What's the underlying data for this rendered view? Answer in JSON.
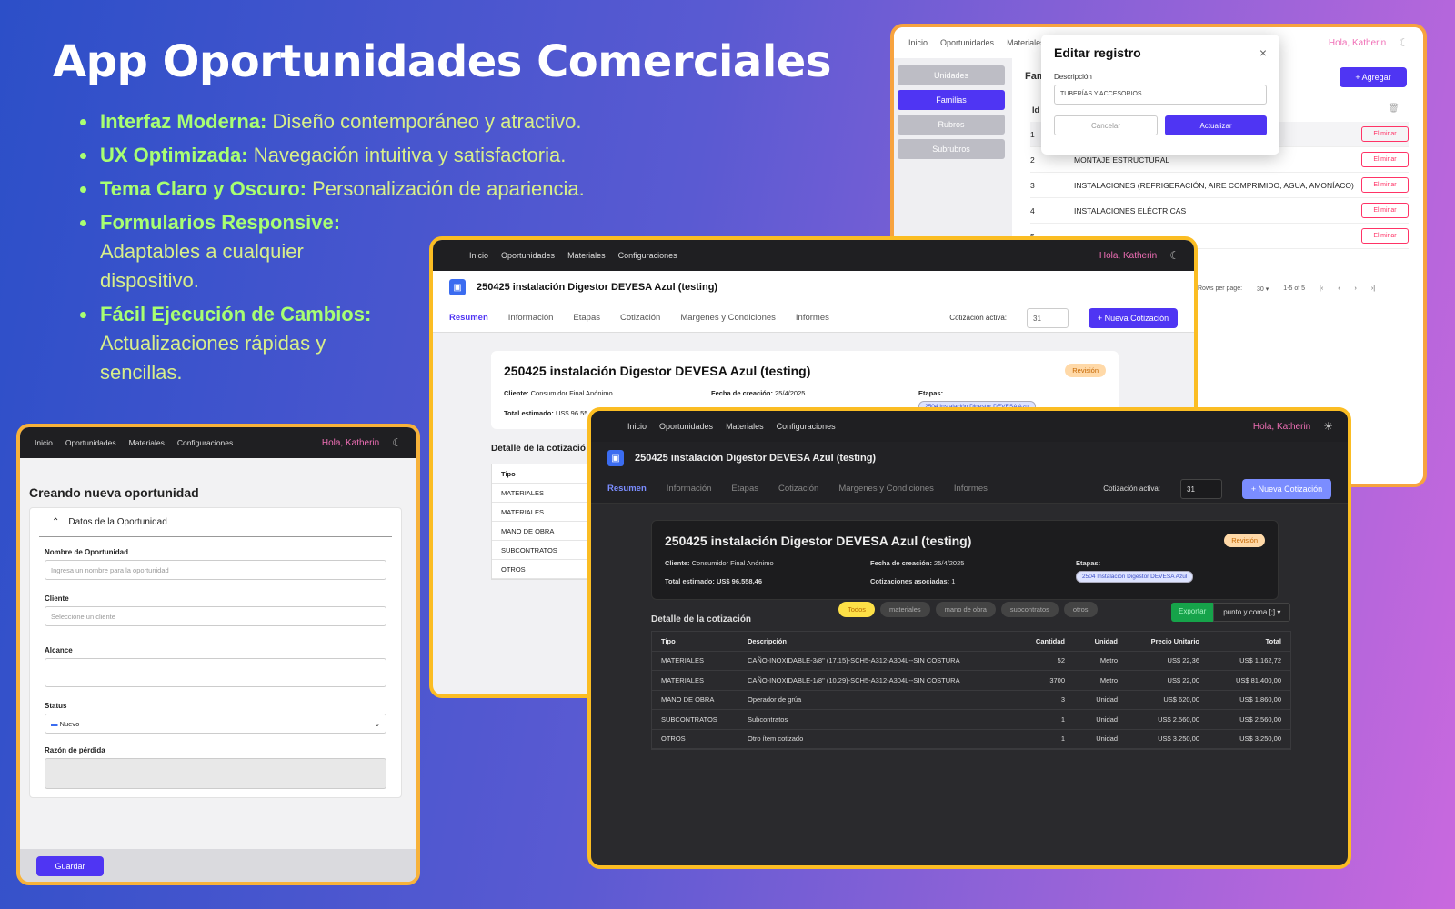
{
  "hero": {
    "title": "App Oportunidades Comerciales",
    "bullets": [
      {
        "bold": "Interfaz Moderna:",
        "text": " Diseño contemporáneo y atractivo."
      },
      {
        "bold": "UX Optimizada:",
        "text": " Navegación intuitiva y satisfactoria."
      },
      {
        "bold": "Tema Claro y Oscuro:",
        "text": " Personalización de apariencia."
      },
      {
        "bold": "Formularios Responsive:",
        "text": " Adaptables a cualquier dispositivo."
      },
      {
        "bold": "Fácil Ejecución de Cambios:",
        "text": " Actualizaciones rápidas y sencillas."
      }
    ]
  },
  "nav": {
    "home": "Inicio",
    "opps": "Oportunidades",
    "materials": "Materiales",
    "config": "Configuraciones",
    "user": "Hola, Katherin"
  },
  "settings": {
    "sidebar": [
      "Unidades",
      "Familias",
      "Rubros",
      "Subrubros"
    ],
    "header_partial": "Fam",
    "add_label": "+ Agregar",
    "id_header": "Id",
    "modal": {
      "title": "Editar registro",
      "field_label": "Descripción",
      "field_value": "TUBERÍAS Y ACCESORIOS",
      "cancel": "Cancelar",
      "update": "Actualizar"
    },
    "rows": [
      {
        "id": "1",
        "desc": ""
      },
      {
        "id": "2",
        "desc": "MONTAJE ESTRUCTURAL"
      },
      {
        "id": "3",
        "desc": "INSTALACIONES (REFRIGERACIÓN, AIRE COMPRIMIDO, AGUA, AMONÍACO)"
      },
      {
        "id": "4",
        "desc": "INSTALACIONES ELÉCTRICAS"
      },
      {
        "id": "5",
        "desc": ""
      }
    ],
    "delete_label": "Eliminar",
    "pagination": {
      "rows_per_page": "Rows per page:",
      "value": "30",
      "range": "1-5 of 5"
    }
  },
  "project": {
    "title": "250425 instalación Digestor DEVESA Azul (testing)",
    "tabs": [
      "Resumen",
      "Información",
      "Etapas",
      "Cotización",
      "Margenes y Condiciones",
      "Informes"
    ],
    "active_label": "Cotización activa:",
    "active_value": "31",
    "new_quote": "+ Nueva Cotización",
    "status": "Revisión",
    "client_label": "Cliente:",
    "client": "Consumidor Final Anónimo",
    "created_label": "Fecha de creación:",
    "created": "25/4/2025",
    "stages_label": "Etapas:",
    "stage": "2504 Instalación Digestor DEVESA Azul",
    "total_label": "Total estimado:",
    "total": "US$ 96.558,46",
    "total_partial": "US$ 96.55",
    "quotes_label": "Cotizaciones asociadas:",
    "quotes": "1",
    "detail_title": "Detalle de la cotización",
    "detail_partial": "Detalle de la cotizació",
    "filters": [
      "Todos",
      "materiales",
      "mano de obra",
      "subcontratos",
      "otros"
    ],
    "export": "Exportar",
    "separator": "punto y coma [;]",
    "columns": [
      "Tipo",
      "Descripción",
      "Cantidad",
      "Unidad",
      "Precio Unitario",
      "Total"
    ],
    "items": [
      {
        "tipo": "MATERIALES",
        "desc": "CAÑO-INOXIDABLE-3/8\" (17.15)-SCH5-A312-A304L--SIN COSTURA",
        "cant": "52",
        "unidad": "Metro",
        "pu": "US$ 22,36",
        "total": "US$ 1.162,72"
      },
      {
        "tipo": "MATERIALES",
        "desc": "CAÑO-INOXIDABLE-1/8\" (10.29)-SCH5-A312-A304L--SIN COSTURA",
        "cant": "3700",
        "unidad": "Metro",
        "pu": "US$ 22,00",
        "total": "US$ 81.400,00"
      },
      {
        "tipo": "MANO DE OBRA",
        "desc": "Operador de grúa",
        "cant": "3",
        "unidad": "Unidad",
        "pu": "US$ 620,00",
        "total": "US$ 1.860,00"
      },
      {
        "tipo": "SUBCONTRATOS",
        "desc": "Subcontratos",
        "cant": "1",
        "unidad": "Unidad",
        "pu": "US$ 2.560,00",
        "total": "US$ 2.560,00"
      },
      {
        "tipo": "OTROS",
        "desc": "Otro ítem cotizado",
        "cant": "1",
        "unidad": "Unidad",
        "pu": "US$ 3.250,00",
        "total": "US$ 3.250,00"
      }
    ]
  },
  "form": {
    "title": "Creando nueva oportunidad",
    "section": "Datos de la Oportunidad",
    "name_label": "Nombre de Oportunidad",
    "name_placeholder": "Ingresa un nombre para la oportunidad",
    "client_label": "Cliente",
    "client_placeholder": "Seleccione un cliente",
    "scope_label": "Alcance",
    "status_label": "Status",
    "status_value": "Nuevo",
    "loss_label": "Razón de pérdida",
    "save": "Guardar"
  }
}
